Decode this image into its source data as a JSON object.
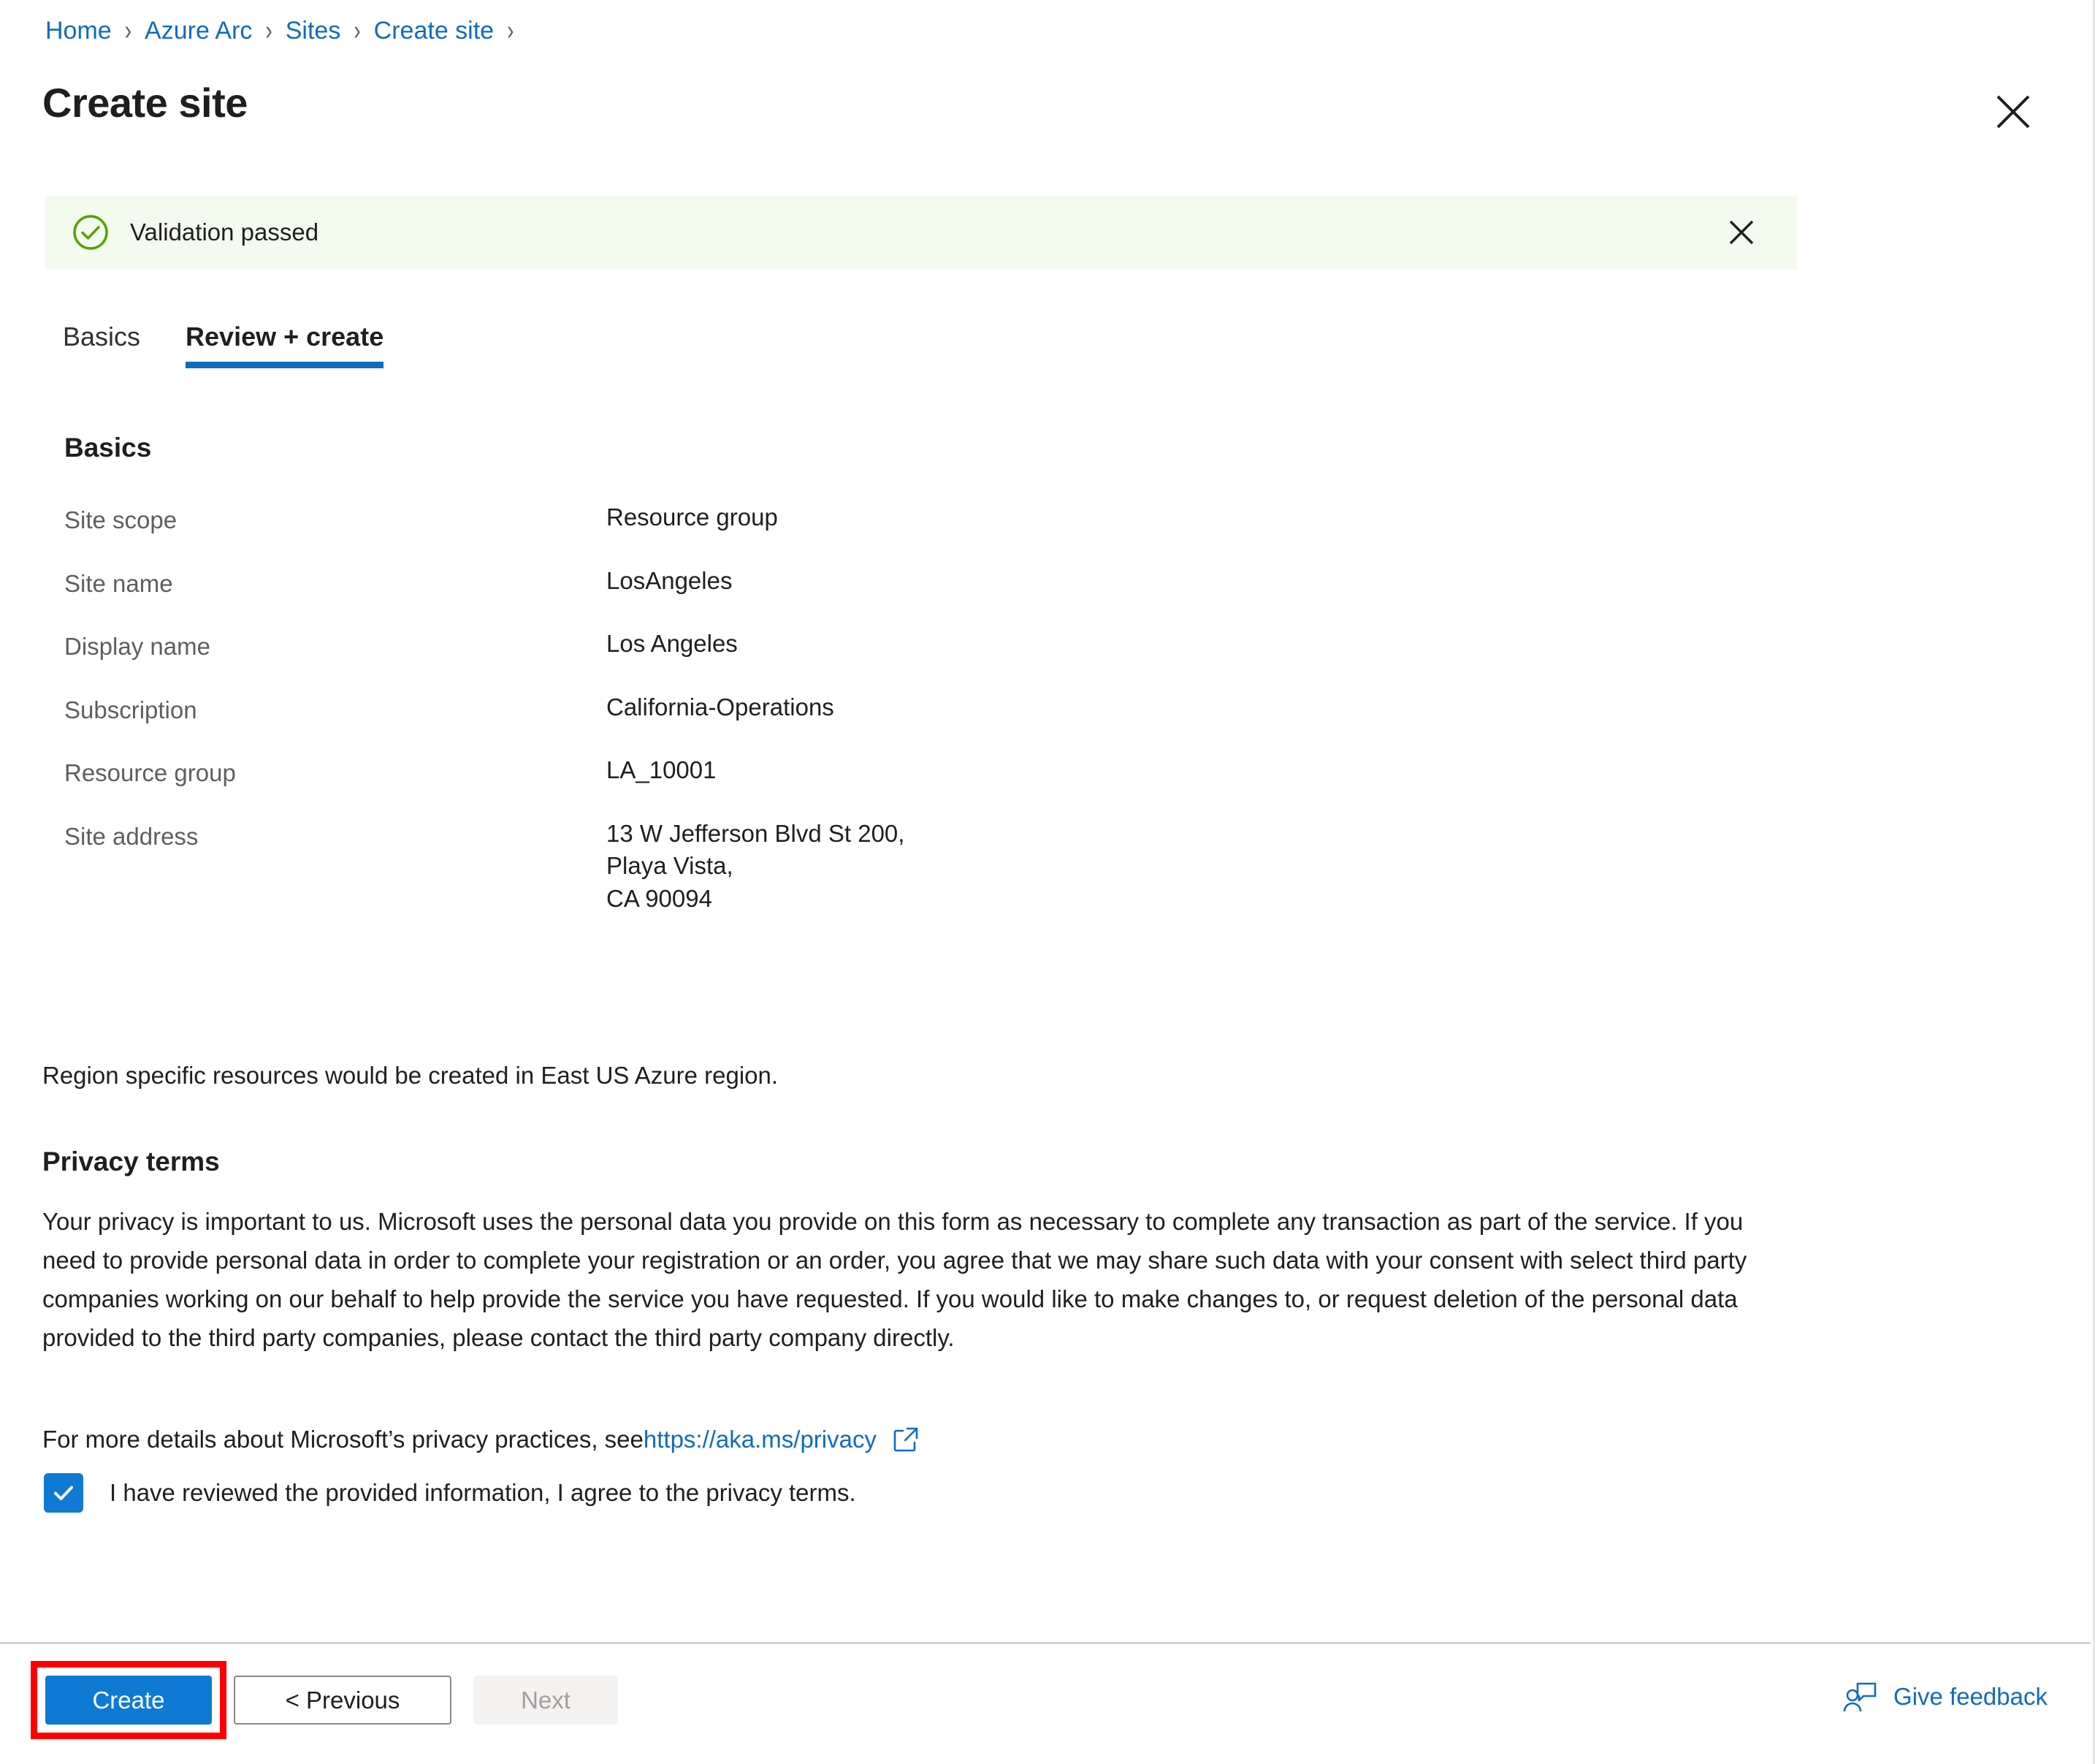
{
  "breadcrumb": {
    "items": [
      {
        "label": "Home"
      },
      {
        "label": "Azure Arc"
      },
      {
        "label": "Sites"
      },
      {
        "label": "Create site"
      }
    ],
    "separator": "›"
  },
  "header": {
    "title": "Create site",
    "close_icon": "close-icon"
  },
  "validation": {
    "icon": "check-circle-icon",
    "message": "Validation passed",
    "close_icon": "close-icon"
  },
  "tabs": [
    {
      "label": "Basics",
      "active": false
    },
    {
      "label": "Review + create",
      "active": true
    }
  ],
  "basics": {
    "heading": "Basics",
    "fields": [
      {
        "label": "Site scope",
        "value": "Resource group"
      },
      {
        "label": "Site name",
        "value": "LosAngeles"
      },
      {
        "label": "Display name",
        "value": "Los Angeles"
      },
      {
        "label": "Subscription",
        "value": "California-Operations"
      },
      {
        "label": "Resource group",
        "value": "LA_10001"
      },
      {
        "label": "Site address",
        "value": "13 W Jefferson Blvd St 200,\nPlaya Vista,\nCA 90094"
      }
    ]
  },
  "region_note": "Region specific resources would be created in East US Azure region.",
  "privacy": {
    "heading": "Privacy terms",
    "body": "Your privacy is important to us. Microsoft uses the personal data you provide on this form as necessary to complete any transaction as part of the service. If you need to provide personal data in order to complete your registration or an order, you agree that we may share such data with your consent with select third party companies working on our behalf to help provide the service you have requested. If you would like to make changes to, or request deletion of the personal data provided to the third party companies, please contact the third party company directly.",
    "link_prefix": "For more details about Microsoft’s privacy practices, see ",
    "link_text": "https://aka.ms/privacy",
    "link_icon": "external-link-icon",
    "consent_label": "I have reviewed the provided information, I agree to the privacy terms.",
    "consent_checked": true
  },
  "footer": {
    "create_label": "Create",
    "previous_label": "< Previous",
    "next_label": "Next",
    "next_disabled": true,
    "feedback_label": "Give feedback",
    "feedback_icon": "person-feedback-icon"
  },
  "colors": {
    "link": "#0f6cbd",
    "primary_button": "#0f7ad4",
    "validation_bg": "#f3faee",
    "validation_icon": "#57a300",
    "highlight_border": "#ff0000",
    "tab_underline": "#0f6cbd",
    "label_text": "#605e5c"
  }
}
